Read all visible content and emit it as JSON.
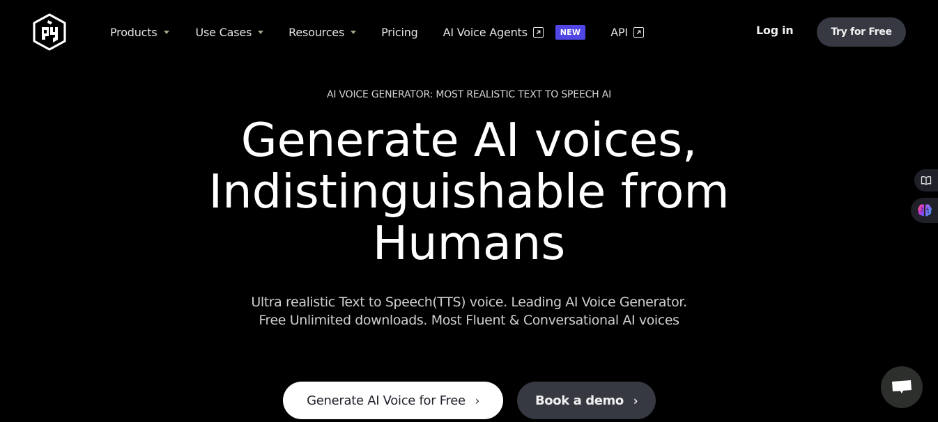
{
  "brand": {
    "logo_icon": "cube-logo-icon"
  },
  "nav": {
    "items": [
      {
        "label": "Products",
        "has_dropdown": true
      },
      {
        "label": "Use Cases",
        "has_dropdown": true
      },
      {
        "label": "Resources",
        "has_dropdown": true
      },
      {
        "label": "Pricing",
        "has_dropdown": false
      },
      {
        "label": "AI Voice Agents",
        "external": true,
        "badge": "NEW"
      },
      {
        "label": "API",
        "external": true
      }
    ],
    "login_label": "Log in",
    "try_label": "Try for Free"
  },
  "hero": {
    "eyebrow": "AI VOICE GENERATOR: MOST REALISTIC TEXT TO SPEECH AI",
    "headline_lines": [
      "Generate AI voices,",
      "Indistinguishable from",
      "Humans"
    ],
    "subtitle_lines": [
      "Ultra realistic Text to Speech(TTS) voice. Leading AI Voice Generator.",
      "Free Unlimited downloads. Most Fluent & Conversational AI voices"
    ],
    "primary_cta": "Generate AI Voice for Free",
    "secondary_cta": "Book a demo"
  },
  "widgets": {
    "book_icon": "book-icon",
    "brain_icon": "brain-icon",
    "chat_icon": "chat-bubble-icon"
  },
  "colors": {
    "background": "#000000",
    "badge": "#5046e5",
    "button_dark": "#373942",
    "chat_fab": "#2c2f2c"
  }
}
